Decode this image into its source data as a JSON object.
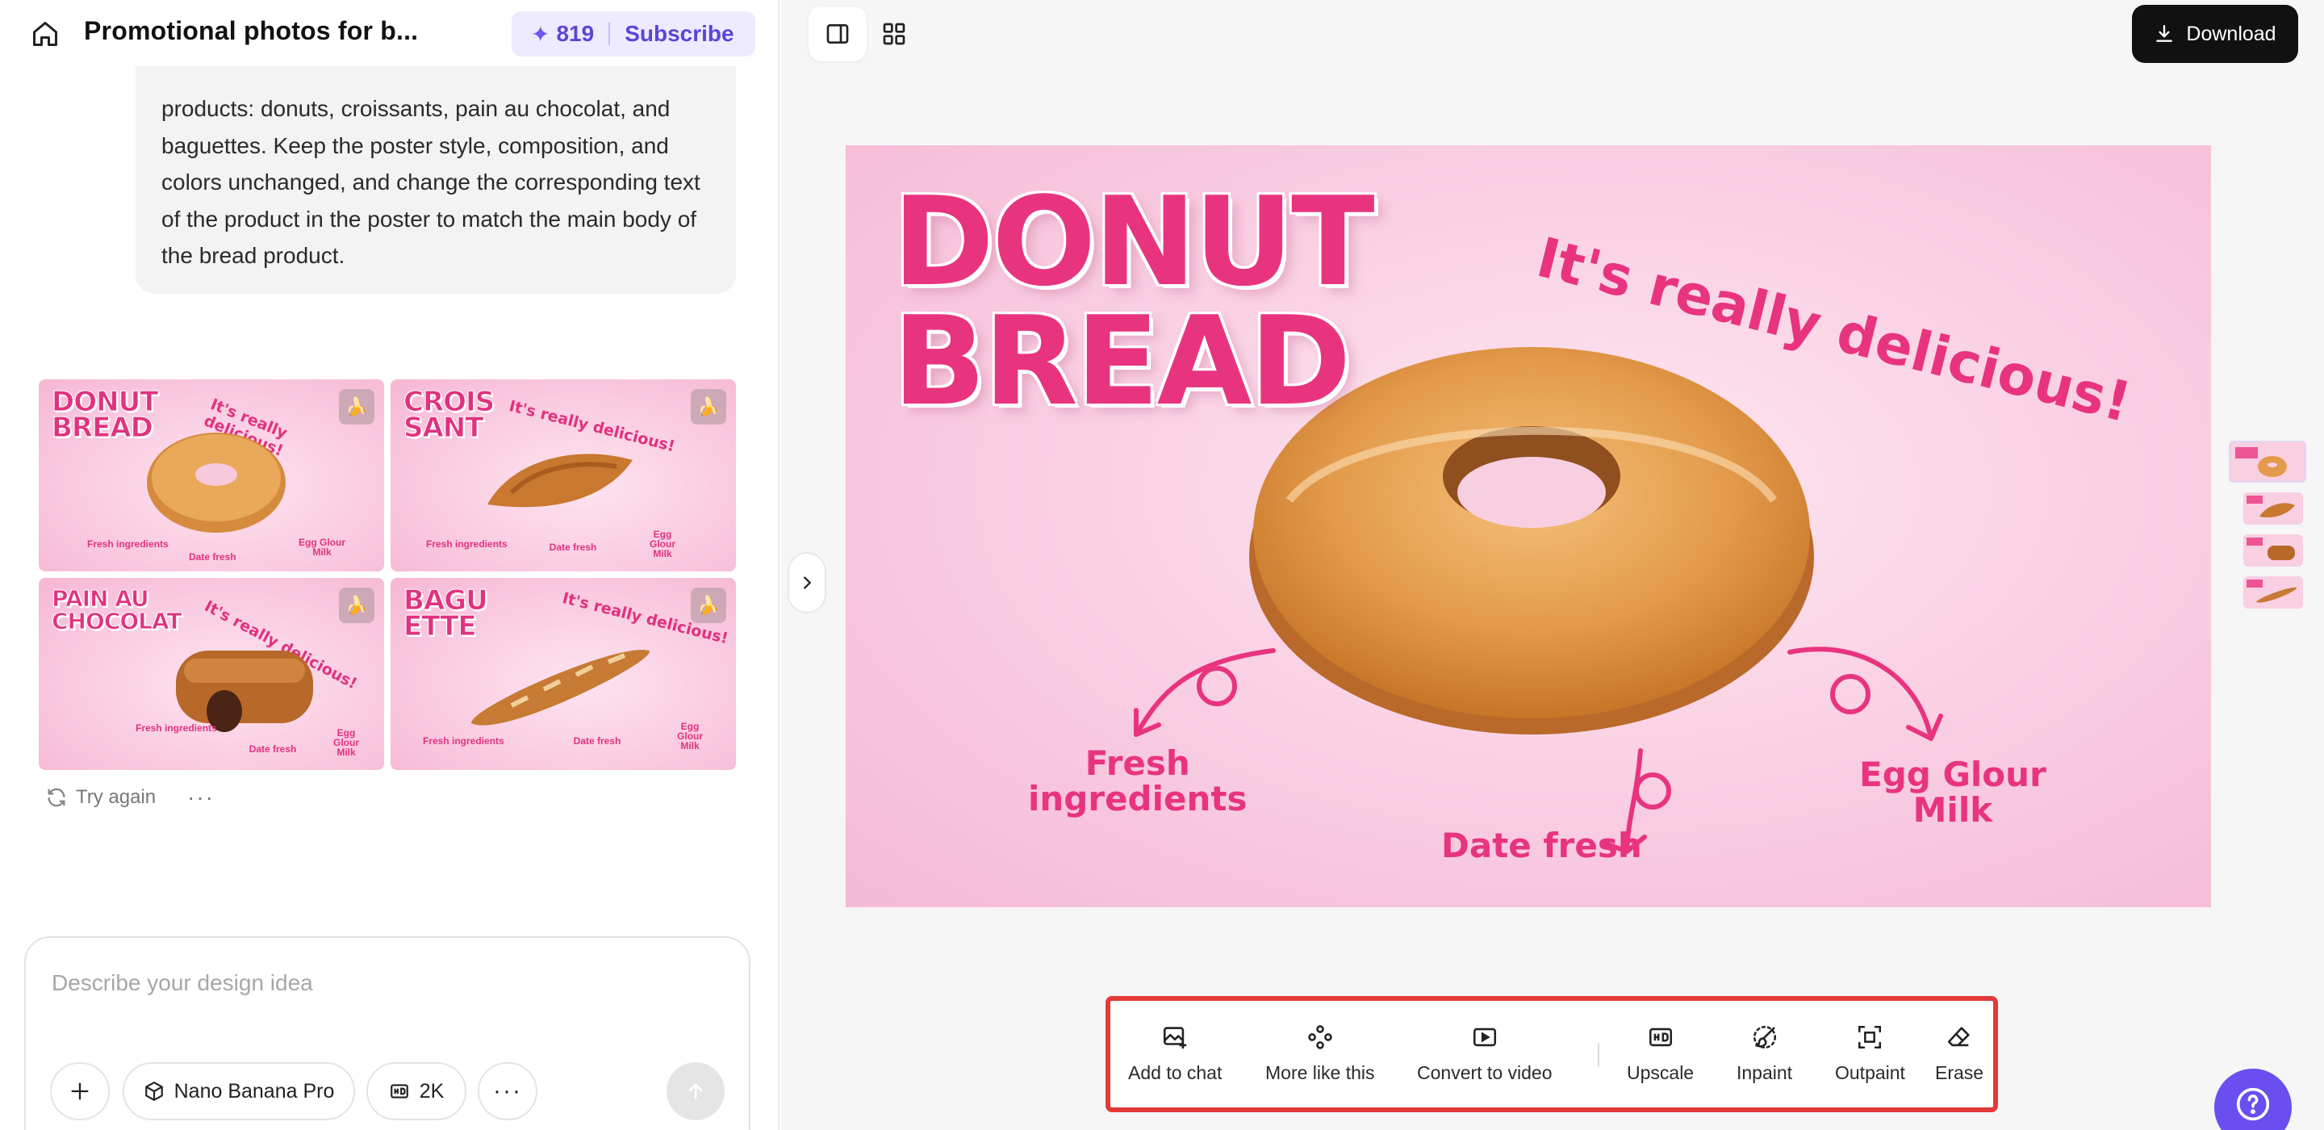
{
  "header": {
    "title": "Promotional photos for b...",
    "credits": "819",
    "subscribe_label": "Subscribe"
  },
  "message": {
    "text": "products: donuts, croissants, pain au chocolat, and baguettes. Keep the poster style, composition, and colors unchanged, and change the corresponding text of the product in the poster to match the main body of the bread product."
  },
  "results": [
    {
      "title": "DONUT\nBREAD",
      "subtitle": "It's really delicious!",
      "labels": [
        "Fresh ingredients",
        "Date fresh",
        "Egg Glour Milk"
      ]
    },
    {
      "title": "CROIS\nSANT",
      "subtitle": "It's really delicious!",
      "labels": [
        "Fresh ingredients",
        "Date fresh",
        "Egg Glour Milk"
      ]
    },
    {
      "title": "PAIN AU\nCHOCOLAT",
      "subtitle": "It's really delicious!",
      "labels": [
        "Fresh ingredients",
        "Date fresh",
        "Egg Glour Milk"
      ]
    },
    {
      "title": "BAGU\nETTE",
      "subtitle": "It's really delicious!",
      "labels": [
        "Fresh ingredients",
        "Date fresh",
        "Egg Glour Milk"
      ]
    }
  ],
  "actions": {
    "try_again": "Try again"
  },
  "composer": {
    "placeholder": "Describe your design idea",
    "model": "Nano Banana Pro",
    "resolution": "2K"
  },
  "canvas": {
    "download_label": "Download",
    "poster": {
      "title": "DONUT\nBREAD",
      "subtitle": "It's really delicious!",
      "label_fresh": "Fresh\ningredients",
      "label_date": "Date fresh",
      "label_egg": "Egg Glour\nMilk"
    }
  },
  "toolbar": {
    "items": [
      {
        "label": "Add to chat",
        "icon": "image-plus-icon"
      },
      {
        "label": "More like this",
        "icon": "sparkle-dots-icon"
      },
      {
        "label": "Convert to video",
        "icon": "video-icon"
      },
      {
        "label": "Upscale",
        "icon": "hd-icon"
      },
      {
        "label": "Inpaint",
        "icon": "brush-icon"
      },
      {
        "label": "Outpaint",
        "icon": "expand-icon"
      },
      {
        "label": "Erase",
        "icon": "eraser-icon"
      }
    ]
  },
  "colors": {
    "accent": "#6a4ef0",
    "poster_pink": "#e8347f",
    "highlight_border": "#e33a3a"
  }
}
